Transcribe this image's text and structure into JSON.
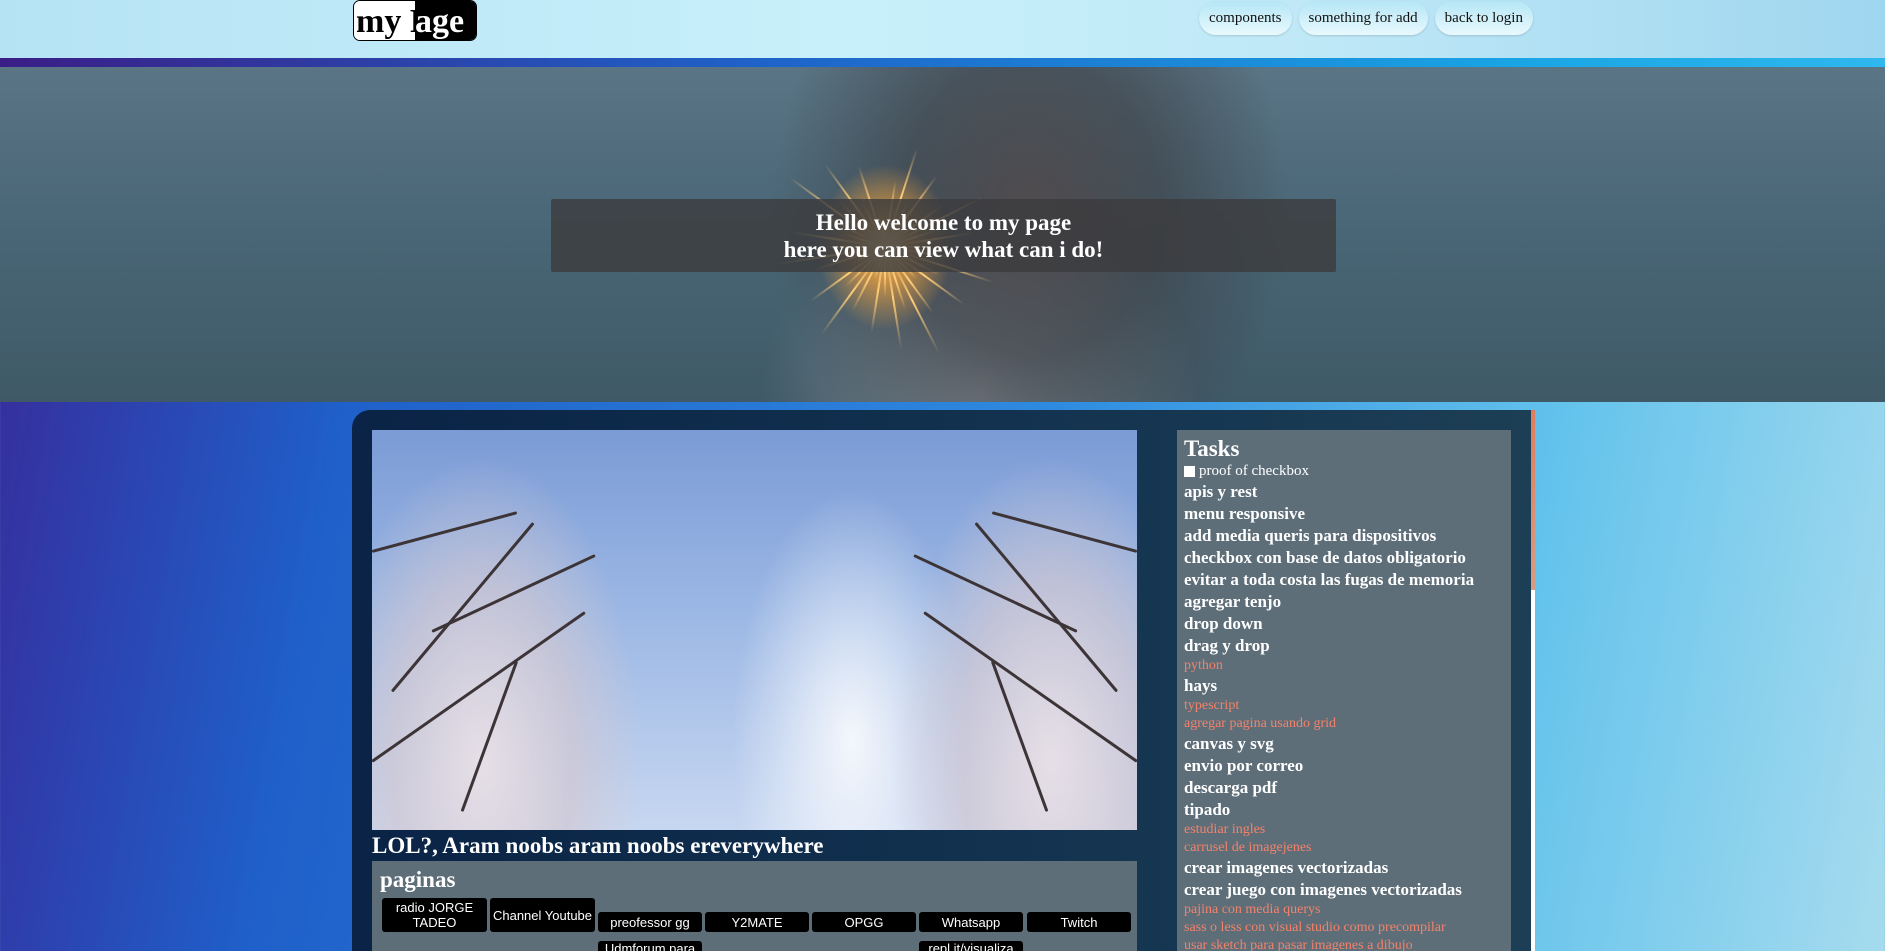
{
  "header": {
    "logo_a": "my P",
    "logo_b": "age",
    "nav": [
      "components",
      "something for add",
      "back to login"
    ]
  },
  "hero": {
    "line1": "Hello welcome to my page",
    "line2": "here you can view what can i do!"
  },
  "content": {
    "caption": "LOL?, Aram noobs aram noobs ereverywhere",
    "pages_title": "paginas",
    "links": [
      "radio JORGE TADEO",
      "Channel Youtube",
      "preofessor gg",
      "Y2MATE",
      "OPGG",
      "Whatsapp",
      "Twitch",
      "Udmforum para",
      "repl.it/visualiza"
    ]
  },
  "tasks": {
    "title": "Tasks",
    "checkbox_label": "proof of checkbox",
    "items": [
      {
        "text": "apis y rest",
        "done": false
      },
      {
        "text": "menu responsive",
        "done": false
      },
      {
        "text": "add media queris para dispositivos",
        "done": false
      },
      {
        "text": "checkbox con base de datos obligatorio",
        "done": false
      },
      {
        "text": "evitar a toda costa las fugas de memoria",
        "done": false
      },
      {
        "text": "agregar tenjo",
        "done": false
      },
      {
        "text": "drop down",
        "done": false
      },
      {
        "text": "drag y drop",
        "done": false
      },
      {
        "text": "python",
        "done": true
      },
      {
        "text": "hays",
        "done": false
      },
      {
        "text": "typescript",
        "done": true
      },
      {
        "text": "agregar pagina usando grid",
        "done": true
      },
      {
        "text": "canvas y svg",
        "done": false
      },
      {
        "text": "envio por correo",
        "done": false
      },
      {
        "text": "descarga pdf",
        "done": false
      },
      {
        "text": "tipado",
        "done": false
      },
      {
        "text": "estudiar ingles",
        "done": true
      },
      {
        "text": "carrusel de imagejenes",
        "done": true
      },
      {
        "text": "crear imagenes vectorizadas",
        "done": false
      },
      {
        "text": "crear juego con imagenes vectorizadas",
        "done": false
      },
      {
        "text": "pajina con media querys",
        "done": true
      },
      {
        "text": "sass o less con visual studio como precompilar",
        "done": true
      },
      {
        "text": "usar sketch para pasar imagenes a dibujo",
        "done": true
      }
    ]
  },
  "colors": {
    "muted_task": "#f4826a",
    "panel": "#5d6e79"
  }
}
